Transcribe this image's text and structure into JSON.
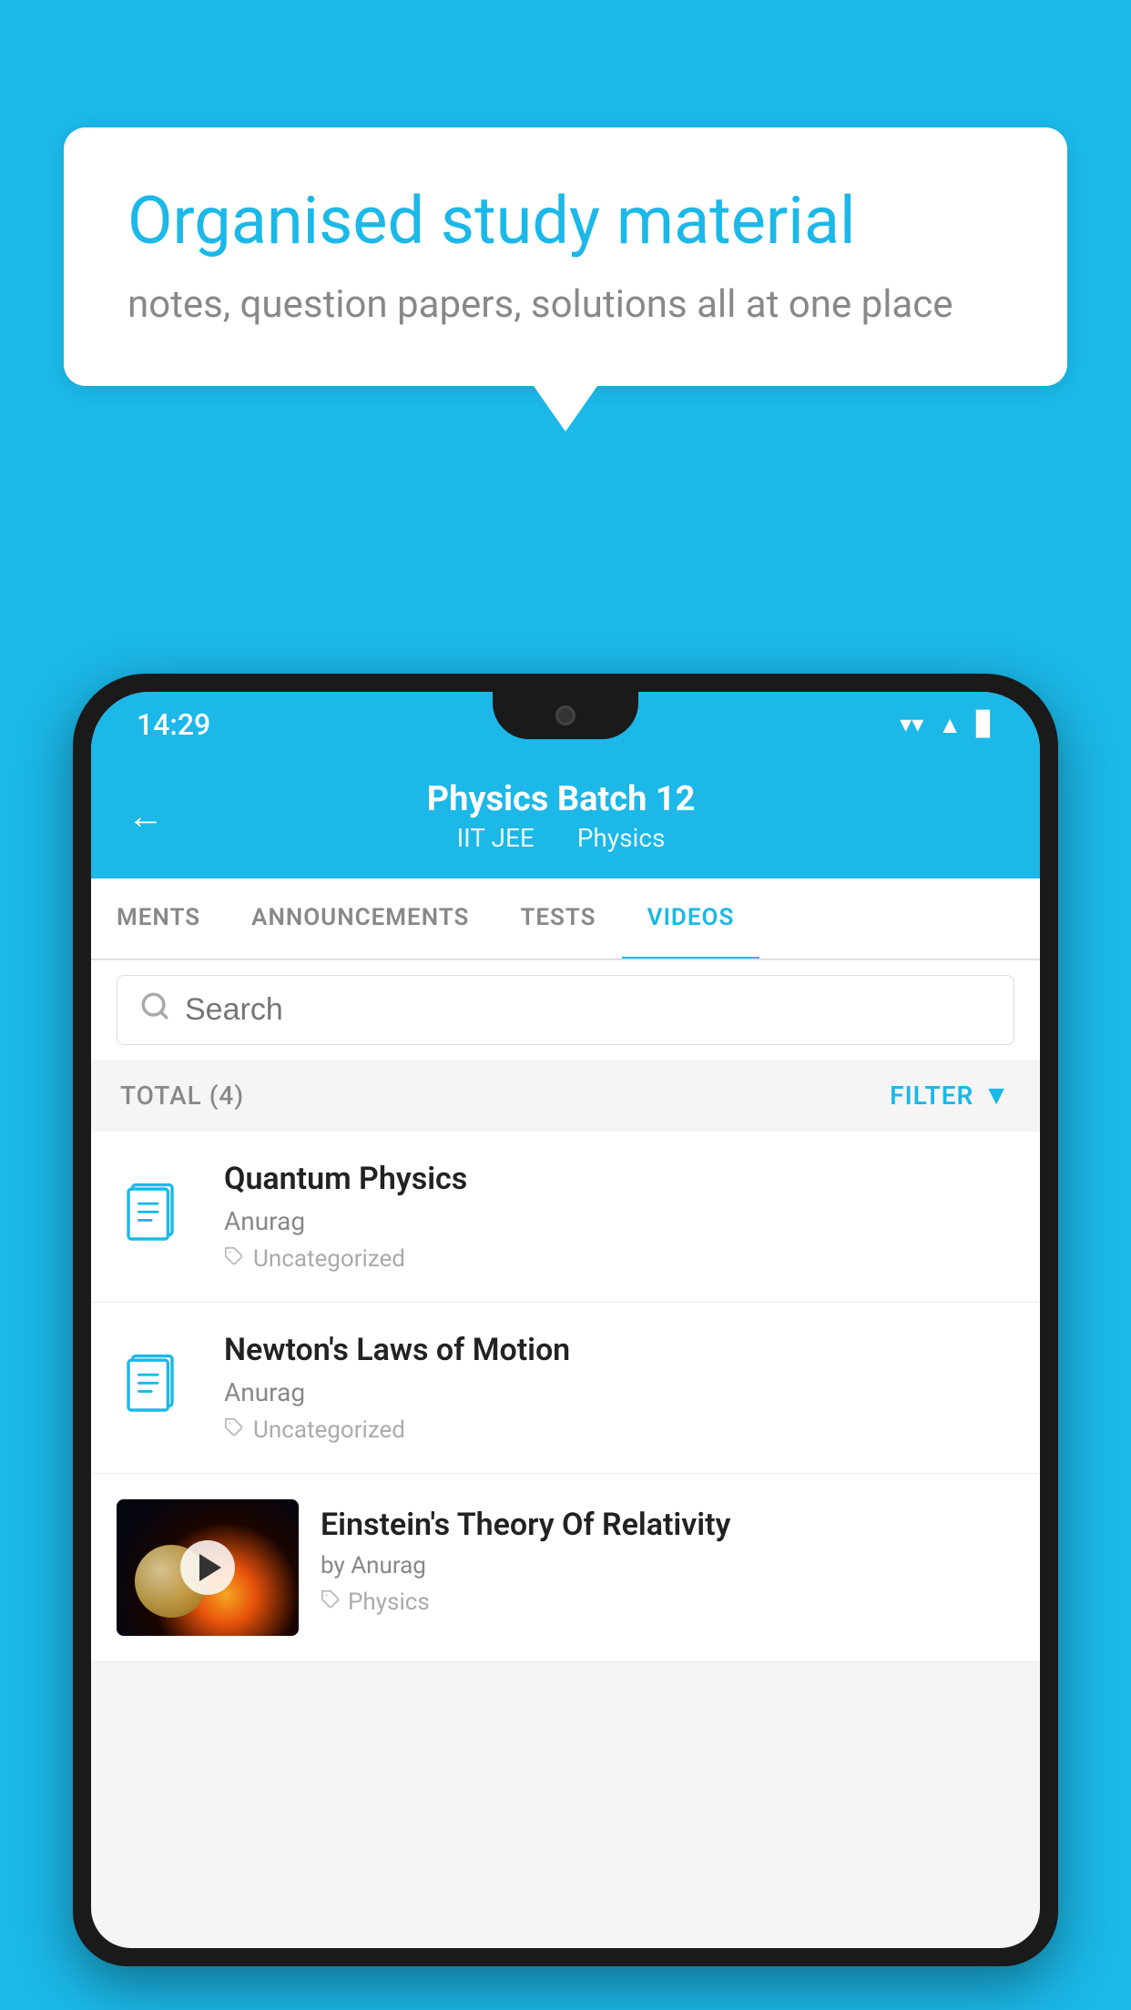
{
  "background_color": "#1BB8E8",
  "speech_bubble": {
    "title": "Organised study material",
    "subtitle": "notes, question papers, solutions all at one place"
  },
  "status_bar": {
    "time": "14:29",
    "wifi": "▼",
    "signal": "▲",
    "battery": "▌"
  },
  "app_bar": {
    "title": "Physics Batch 12",
    "subtitle_category": "IIT JEE",
    "subtitle_subject": "Physics",
    "back_label": "←"
  },
  "tabs": [
    {
      "label": "MENTS",
      "active": false
    },
    {
      "label": "ANNOUNCEMENTS",
      "active": false
    },
    {
      "label": "TESTS",
      "active": false
    },
    {
      "label": "VIDEOS",
      "active": true
    }
  ],
  "search": {
    "placeholder": "Search"
  },
  "filter_bar": {
    "total_label": "TOTAL (4)",
    "filter_label": "FILTER"
  },
  "video_items": [
    {
      "title": "Quantum Physics",
      "author": "Anurag",
      "tag": "Uncategorized",
      "type": "file"
    },
    {
      "title": "Newton's Laws of Motion",
      "author": "Anurag",
      "tag": "Uncategorized",
      "type": "file"
    },
    {
      "title": "Einstein's Theory Of Relativity",
      "author": "by Anurag",
      "tag": "Physics",
      "type": "video"
    }
  ]
}
